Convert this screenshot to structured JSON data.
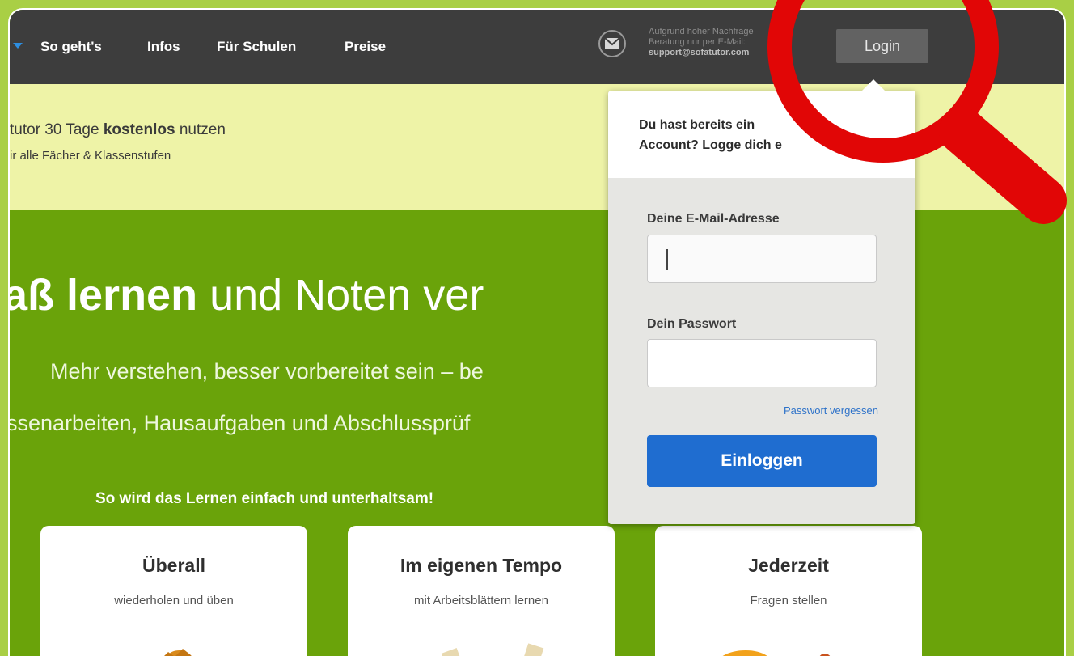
{
  "nav": {
    "links": [
      "So geht's",
      "Infos",
      "Für Schulen",
      "Preise"
    ],
    "support": {
      "line1": "Aufgrund hoher Nachfrage",
      "line2": "Beratung nur per E-Mail:",
      "email": "support@sofatutor.com"
    },
    "login_label": "Login"
  },
  "promo": {
    "line1_pre": "tutor 30 Tage ",
    "line1_bold": "kostenlos",
    "line1_post": " nutzen",
    "line2": "ir alle Fächer & Klassenstufen"
  },
  "hero": {
    "title_bold": "aß lernen",
    "title_rest": " und Noten ver",
    "sub1": "Mehr verstehen, besser vorbereitet sein – be",
    "sub2": "ssenarbeiten, Hausaufgaben und Abschlussprüf",
    "steps_heading": "So wird das Lernen einfach und unterhaltsam!"
  },
  "cards": [
    {
      "title": "Überall",
      "subtitle": "wiederholen und üben"
    },
    {
      "title": "Im eigenen Tempo",
      "subtitle": "mit Arbeitsblättern lernen"
    },
    {
      "title": "Jederzeit",
      "subtitle": "Fragen stellen"
    }
  ],
  "login_panel": {
    "intro_line1": "Du hast bereits ein",
    "intro_line2": "Account? Logge dich e",
    "email_label": "Deine E-Mail-Adresse",
    "email_value": "",
    "password_label": "Dein Passwort",
    "password_value": "",
    "forgot_label": "Passwort vergessen",
    "submit_label": "Einloggen"
  },
  "colors": {
    "frame_bg": "#a9cf45",
    "nav_bg": "#3d3d3d",
    "promo_bg": "#eef3a7",
    "hero_bg": "#6aa30a",
    "accent_blue": "#1f6dd0",
    "magnifier_red": "#e10606"
  },
  "icons": {
    "nav_caret": "caret-down-icon",
    "mail": "envelope-icon",
    "magnifier": "magnifying-glass-icon"
  }
}
